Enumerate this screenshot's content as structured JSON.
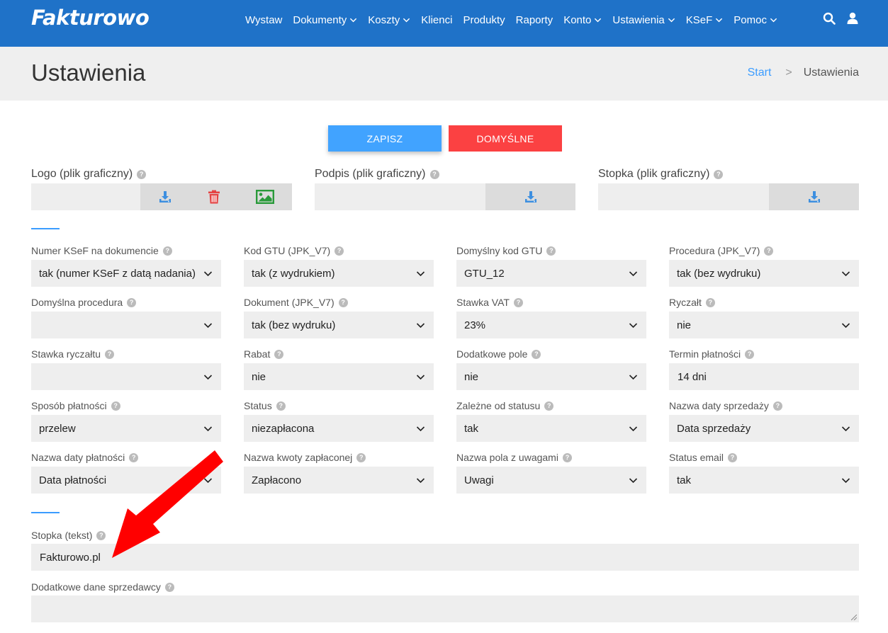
{
  "brand": {
    "logo_text": "Fakturowo"
  },
  "nav": {
    "items": [
      {
        "label": "Wystaw",
        "dropdown": false
      },
      {
        "label": "Dokumenty",
        "dropdown": true
      },
      {
        "label": "Koszty",
        "dropdown": true
      },
      {
        "label": "Klienci",
        "dropdown": false
      },
      {
        "label": "Produkty",
        "dropdown": false
      },
      {
        "label": "Raporty",
        "dropdown": false
      },
      {
        "label": "Konto",
        "dropdown": true
      },
      {
        "label": "Ustawienia",
        "dropdown": true
      },
      {
        "label": "KSeF",
        "dropdown": true
      },
      {
        "label": "Pomoc",
        "dropdown": true
      }
    ],
    "icons": [
      "search-icon",
      "user-icon"
    ]
  },
  "page": {
    "title": "Ustawienia",
    "breadcrumb": {
      "home": "Start",
      "separator": ">",
      "current": "Ustawienia"
    }
  },
  "actions": {
    "save_label": "ZAPISZ",
    "default_label": "DOMYŚLNE"
  },
  "uploads": {
    "logo": {
      "label": "Logo (plik graficzny)"
    },
    "signature": {
      "label": "Podpis (plik graficzny)"
    },
    "footer": {
      "label": "Stopka (plik graficzny)"
    }
  },
  "help_glyph": "?",
  "fields": [
    {
      "label": "Numer KSeF na dokumencie",
      "value": "tak (numer KSeF z datą nadania)",
      "type": "select"
    },
    {
      "label": "Kod GTU (JPK_V7)",
      "value": "tak (z wydrukiem)",
      "type": "select"
    },
    {
      "label": "Domyślny kod GTU",
      "value": "GTU_12",
      "type": "select"
    },
    {
      "label": "Procedura (JPK_V7)",
      "value": "tak (bez wydruku)",
      "type": "select"
    },
    {
      "label": "Domyślna procedura",
      "value": "",
      "type": "select"
    },
    {
      "label": "Dokument (JPK_V7)",
      "value": "tak (bez wydruku)",
      "type": "select"
    },
    {
      "label": "Stawka VAT",
      "value": "23%",
      "type": "select"
    },
    {
      "label": "Ryczałt",
      "value": "nie",
      "type": "select"
    },
    {
      "label": "Stawka ryczałtu",
      "value": "",
      "type": "select"
    },
    {
      "label": "Rabat",
      "value": "nie",
      "type": "select"
    },
    {
      "label": "Dodatkowe pole",
      "value": "nie",
      "type": "select"
    },
    {
      "label": "Termin płatności",
      "value": "14 dni",
      "type": "input"
    },
    {
      "label": "Sposób płatności",
      "value": "przelew",
      "type": "select"
    },
    {
      "label": "Status",
      "value": "niezapłacona",
      "type": "select"
    },
    {
      "label": "Zależne od statusu",
      "value": "tak",
      "type": "select"
    },
    {
      "label": "Nazwa daty sprzedaży",
      "value": "Data sprzedaży",
      "type": "select"
    },
    {
      "label": "Nazwa daty płatności",
      "value": "Data płatności",
      "type": "select"
    },
    {
      "label": "Nazwa kwoty zapłaconej",
      "value": "Zapłacono",
      "type": "select"
    },
    {
      "label": "Nazwa pola z uwagami",
      "value": "Uwagi",
      "type": "select"
    },
    {
      "label": "Status email",
      "value": "tak",
      "type": "select"
    }
  ],
  "footer_text": {
    "label": "Stopka (tekst)",
    "value": "Fakturowo.pl"
  },
  "seller_data": {
    "label": "Dodatkowe dane sprzedawcy",
    "value": ""
  },
  "colors": {
    "navbar": "#1f72c8",
    "primary": "#41a3ff",
    "danger": "#fb4142",
    "field_bg": "#eeeeee",
    "annotation_arrow": "#ff0000"
  }
}
